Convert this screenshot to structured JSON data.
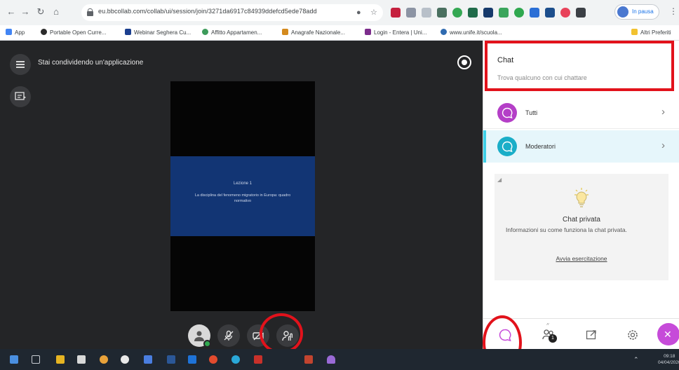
{
  "browser": {
    "url": "eu.bbcollab.com/collab/ui/session/join/3271da6917c84939ddefcd5ede78add",
    "profile_label": "In pausa",
    "bookmarks": [
      {
        "label": "App",
        "color": "#4285f4"
      },
      {
        "label": "Portable Open Curre...",
        "color": "#2b2b2b"
      },
      {
        "label": "Webinar Seghera Cu...",
        "color": "#1b3f8f"
      },
      {
        "label": "Affitto Appartamen...",
        "color": "#3d9b5b"
      },
      {
        "label": "Anagrafe Nazionale...",
        "color": "#d48a1e"
      },
      {
        "label": "Login - Entera | Uni...",
        "color": "#7c2d8c"
      },
      {
        "label": "www.unife.it/scuola...",
        "color": "#2f6bb0"
      }
    ],
    "bookmark_other": "Altri Preferiti"
  },
  "meeting": {
    "share_status": "Stai condividendo un'applicazione",
    "slide": {
      "title": "Lezione 1",
      "body": "La disciplina del fenomeno migratorio in Europa: quadro normativo"
    }
  },
  "chat": {
    "title": "Chat",
    "search_placeholder": "Trova qualcuno con cui chattare",
    "channels": [
      {
        "label": "Tutti",
        "icon": "chat-bubble-icon",
        "color": "#b43fc7"
      },
      {
        "label": "Moderatori",
        "icon": "chat-bubble-icon",
        "color": "#1aaec8"
      }
    ],
    "private": {
      "title": "Chat privata",
      "description": "Informazioni su come funziona la chat privata.",
      "link": "Avvia esercitazione"
    },
    "participants_count": "1",
    "close_symbol": "✕"
  },
  "taskbar": {
    "time": "09:18",
    "date": "04/04/2020"
  },
  "colors": {
    "meeting_bg": "#242527",
    "slide_bg": "#123574",
    "accent_purple": "#c64bd9",
    "highlight_red": "#e2121b"
  }
}
